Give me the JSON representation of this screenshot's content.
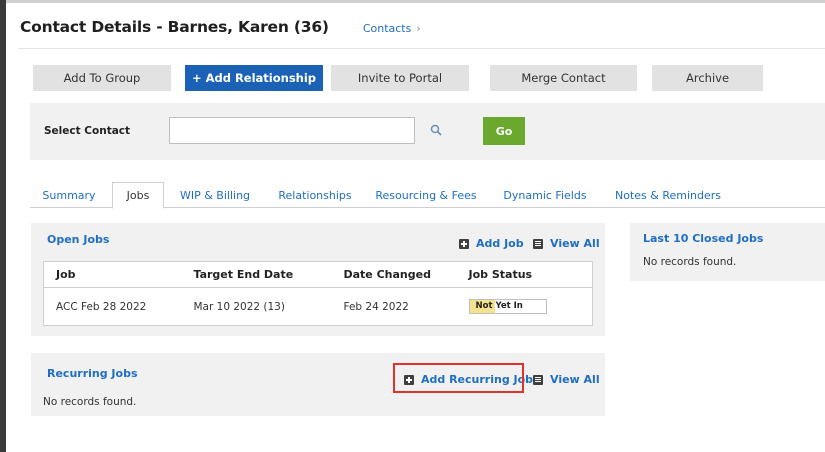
{
  "header": {
    "title": "Contact Details - Barnes, Karen (36)",
    "breadcrumb": "Contacts",
    "breadcrumb_sep": "›"
  },
  "toolbar": {
    "add_to_group": "Add To Group",
    "add_relationship": "+ Add Relationship",
    "invite_to_portal": "Invite to Portal",
    "merge_contact": "Merge Contact",
    "archive": "Archive"
  },
  "search": {
    "label": "Select Contact",
    "value": "",
    "go_label": "Go"
  },
  "tabs": [
    {
      "label": "Summary"
    },
    {
      "label": "Jobs"
    },
    {
      "label": "WIP & Billing"
    },
    {
      "label": "Relationships"
    },
    {
      "label": "Resourcing & Fees"
    },
    {
      "label": "Dynamic Fields"
    },
    {
      "label": "Notes & Reminders"
    }
  ],
  "open_jobs": {
    "title": "Open Jobs",
    "add_job": "Add Job",
    "view_all": "View All",
    "columns": [
      "Job",
      "Target End Date",
      "Date Changed",
      "Job Status"
    ],
    "rows": [
      {
        "job": "ACC Feb 28 2022",
        "target_end_date": "Mar 10 2022 (13)",
        "date_changed": "Feb 24 2022",
        "job_status": "Not Yet In"
      }
    ]
  },
  "closed_jobs": {
    "title": "Last 10 Closed Jobs",
    "empty": "No records found."
  },
  "recurring_jobs": {
    "title": "Recurring Jobs",
    "add_recurring_job": "Add Recurring Job",
    "view_all": "View All",
    "empty": "No records found."
  },
  "colors": {
    "accent_blue": "#1b62b7",
    "link_blue": "#1f6ec1",
    "go_green": "#6aa82e",
    "highlight_red": "#e0312d",
    "status_yellow": "#f4e28d"
  }
}
